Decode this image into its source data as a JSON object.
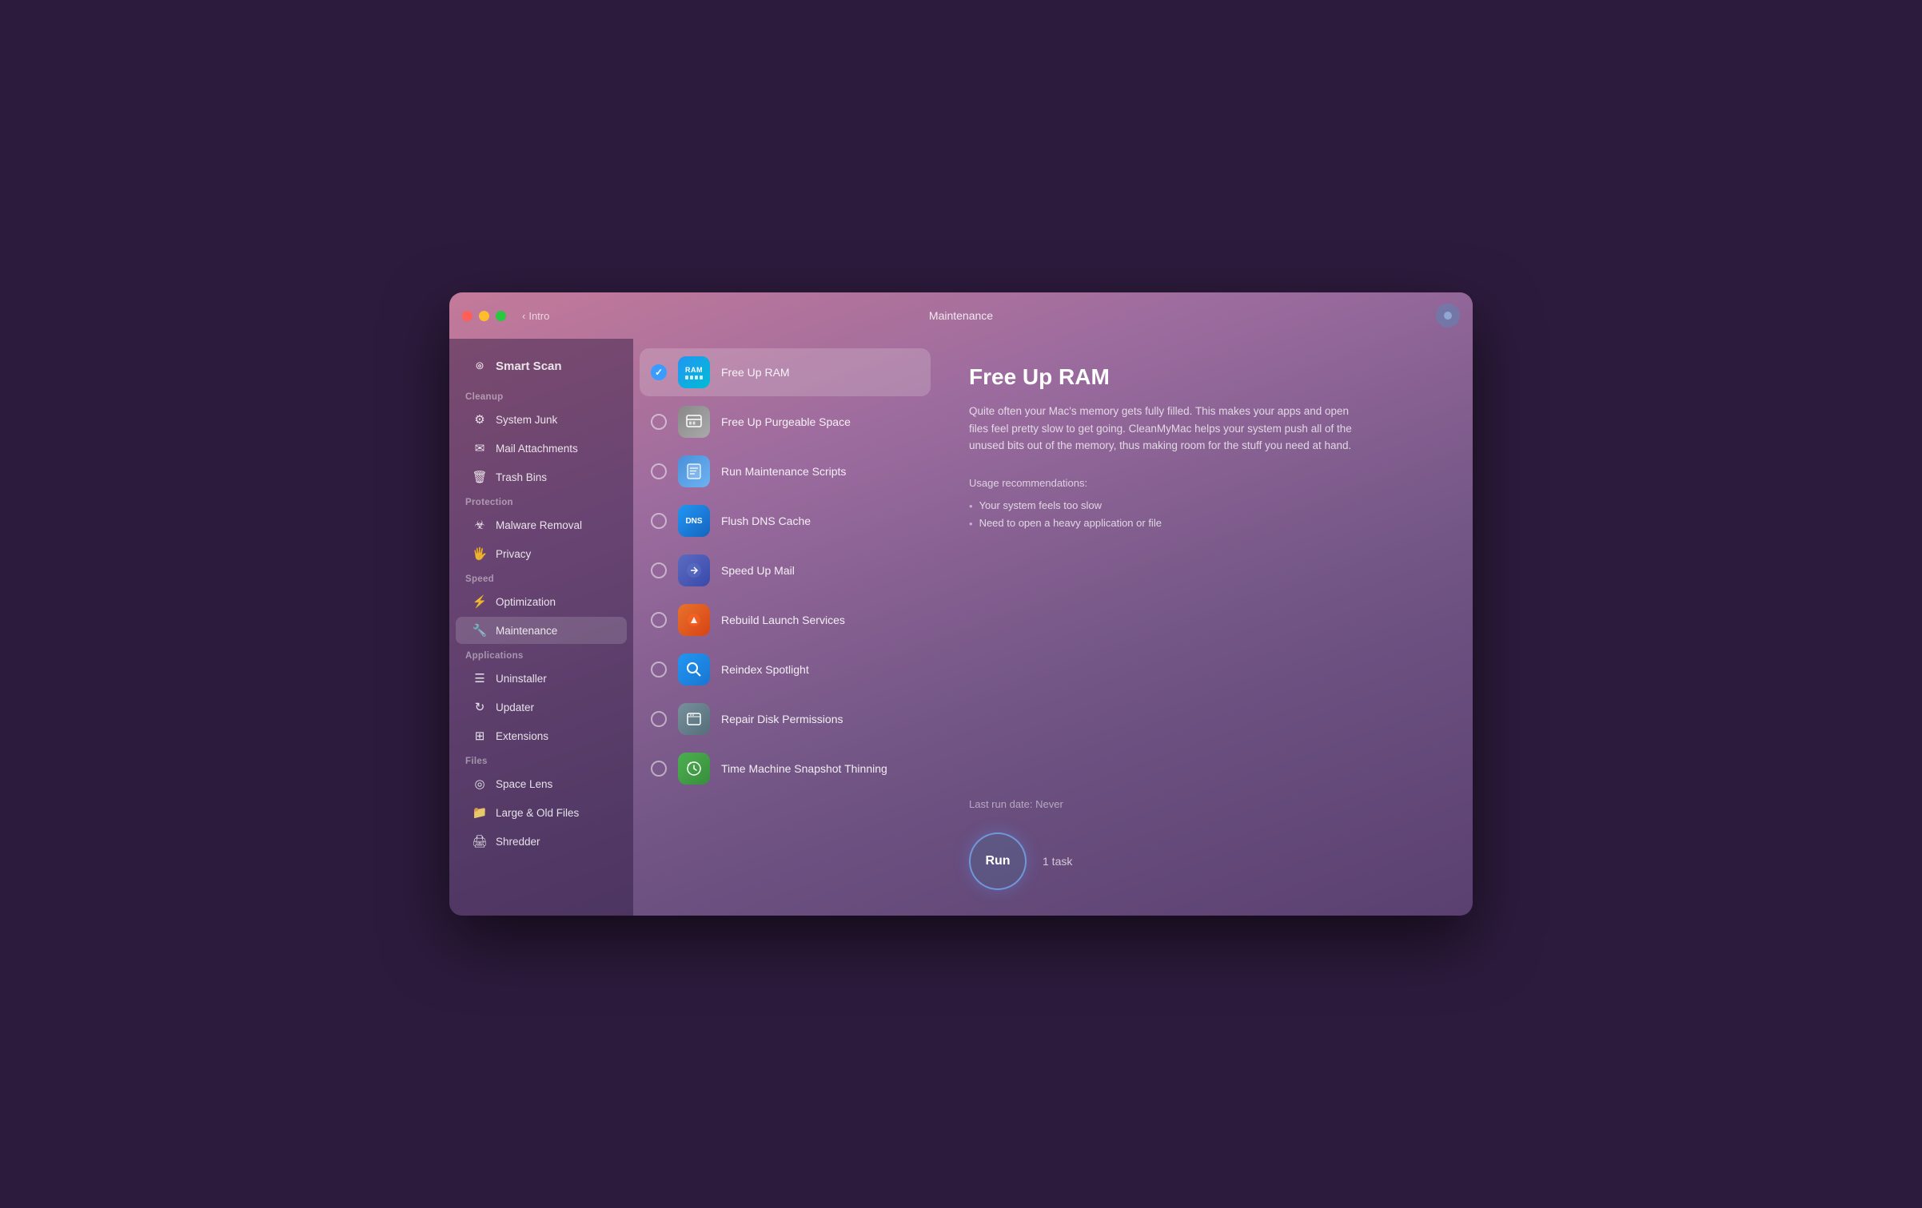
{
  "window": {
    "titlebar": {
      "back_label": "Intro",
      "page_title": "Maintenance",
      "profile_icon": "profile-icon"
    }
  },
  "sidebar": {
    "smart_scan_label": "Smart Scan",
    "sections": [
      {
        "label": "Cleanup",
        "items": [
          {
            "id": "system-junk",
            "label": "System Junk",
            "icon": "⚙"
          },
          {
            "id": "mail-attachments",
            "label": "Mail Attachments",
            "icon": "✉"
          },
          {
            "id": "trash-bins",
            "label": "Trash Bins",
            "icon": "🗑"
          }
        ]
      },
      {
        "label": "Protection",
        "items": [
          {
            "id": "malware-removal",
            "label": "Malware Removal",
            "icon": "☣"
          },
          {
            "id": "privacy",
            "label": "Privacy",
            "icon": "🖐"
          }
        ]
      },
      {
        "label": "Speed",
        "items": [
          {
            "id": "optimization",
            "label": "Optimization",
            "icon": "⚡"
          },
          {
            "id": "maintenance",
            "label": "Maintenance",
            "icon": "🔧",
            "active": true
          }
        ]
      },
      {
        "label": "Applications",
        "items": [
          {
            "id": "uninstaller",
            "label": "Uninstaller",
            "icon": "☰"
          },
          {
            "id": "updater",
            "label": "Updater",
            "icon": "↻"
          },
          {
            "id": "extensions",
            "label": "Extensions",
            "icon": "⊞"
          }
        ]
      },
      {
        "label": "Files",
        "items": [
          {
            "id": "space-lens",
            "label": "Space Lens",
            "icon": "◎"
          },
          {
            "id": "large-old-files",
            "label": "Large & Old Files",
            "icon": "📁"
          },
          {
            "id": "shredder",
            "label": "Shredder",
            "icon": "🖨"
          }
        ]
      }
    ]
  },
  "tasks": [
    {
      "id": "free-up-ram",
      "label": "Free Up RAM",
      "checked": true,
      "selected": true,
      "icon_type": "ram"
    },
    {
      "id": "free-up-purgeable",
      "label": "Free Up Purgeable Space",
      "checked": false,
      "selected": false,
      "icon_type": "purgeable"
    },
    {
      "id": "run-maintenance-scripts",
      "label": "Run Maintenance Scripts",
      "checked": false,
      "selected": false,
      "icon_type": "scripts"
    },
    {
      "id": "flush-dns-cache",
      "label": "Flush DNS Cache",
      "checked": false,
      "selected": false,
      "icon_type": "dns"
    },
    {
      "id": "speed-up-mail",
      "label": "Speed Up Mail",
      "checked": false,
      "selected": false,
      "icon_type": "mail"
    },
    {
      "id": "rebuild-launch-services",
      "label": "Rebuild Launch Services",
      "checked": false,
      "selected": false,
      "icon_type": "launch"
    },
    {
      "id": "reindex-spotlight",
      "label": "Reindex Spotlight",
      "checked": false,
      "selected": false,
      "icon_type": "spotlight"
    },
    {
      "id": "repair-disk-permissions",
      "label": "Repair Disk Permissions",
      "checked": false,
      "selected": false,
      "icon_type": "disk"
    },
    {
      "id": "time-machine-thinning",
      "label": "Time Machine Snapshot Thinning",
      "checked": false,
      "selected": false,
      "icon_type": "timemachine"
    }
  ],
  "detail": {
    "title": "Free Up RAM",
    "description": "Quite often your Mac's memory gets fully filled. This makes your apps and open files feel pretty slow to get going. CleanMyMac helps your system push all of the unused bits out of the memory, thus making room for the stuff you need at hand.",
    "usage_title": "Usage recommendations:",
    "usage_items": [
      "Your system feels too slow",
      "Need to open a heavy application or file"
    ],
    "last_run_label": "Last run date:",
    "last_run_value": "Never",
    "run_button_label": "Run",
    "task_count_label": "1 task"
  }
}
